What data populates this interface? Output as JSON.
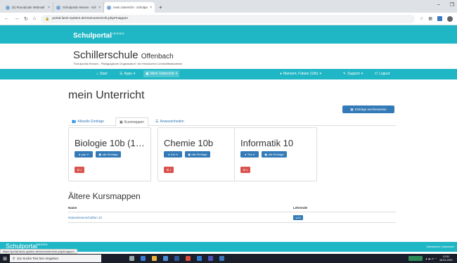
{
  "browser": {
    "tabs": [
      {
        "label": "(6) Roundcube Webmail :: Postei",
        "active": false
      },
      {
        "label": "Schulportal Hessen - Schulpo",
        "active": false
      },
      {
        "label": "mein Unterricht - Schulportal He",
        "active": true
      }
    ],
    "new_tab": "+",
    "url": "portal.lanis-system.de/meinunterricht.php#mappen"
  },
  "portal": {
    "brand": "Schulportal",
    "brand_sup": "HESSEN",
    "school_name": "Schillerschule",
    "school_city": "Offenbach",
    "slogan": "\"Schulportal Hessen - Pädagogische Organisation\" der Hessischen Lehrkräfteakademie"
  },
  "navbar": {
    "start": "Start",
    "apps": "Apps",
    "current": "Mein Unterricht",
    "user": "Mannert, Fabian (10b)",
    "support": "Support",
    "logout": "Logout"
  },
  "page": {
    "title": "mein Unterricht",
    "weekly_button": "Einträge wochenweise",
    "tabs": [
      "Aktuelle Einträge",
      "Kursmappen",
      "Anwesenheiten"
    ],
    "active_tab": "Kursmappen"
  },
  "courses": [
    {
      "title": "Biologie 10b (1…",
      "teacher": "pep",
      "all_entries": "alle Einträge",
      "badge": "1"
    },
    {
      "title": "Chemie 10b",
      "teacher": "Krö",
      "all_entries": "alle Einträge",
      "badge": "1"
    },
    {
      "title": "Informatik 10",
      "teacher": "Ths",
      "all_entries": "alle Einträge",
      "badge": "1"
    }
  ],
  "older": {
    "heading": "Ältere Kursmappen",
    "col_name": "Name",
    "col_teacher": "Lehrende",
    "rows": [
      {
        "name": "Naturwissenschaften 10",
        "teacher": "Kö"
      }
    ]
  },
  "footer": {
    "brand": "Schulportal",
    "brand_sup": "HESSEN",
    "links": "Datenschutz | Impressum",
    "status_url": "https://portal.lanis-system.de/meinunterricht.php#mappen"
  },
  "taskbar": {
    "search_placeholder": "Zur Suche Text hier eingeben",
    "time": "12:51",
    "date": "18.02.2021"
  },
  "colors": {
    "portal": "#1fb6c5",
    "primary": "#337ab7",
    "danger": "#d9534f"
  }
}
